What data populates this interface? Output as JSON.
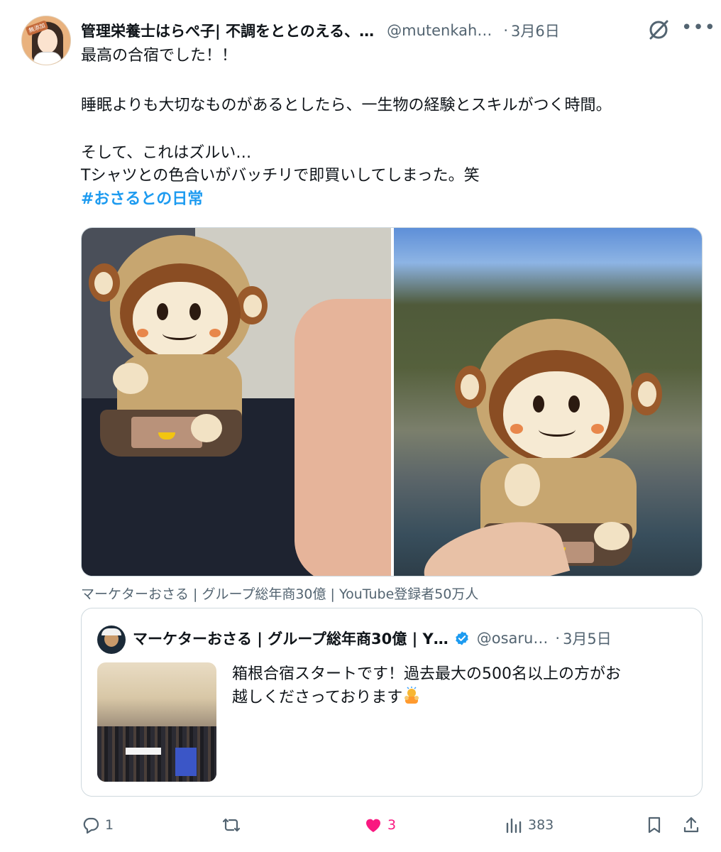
{
  "author": {
    "display_name": "管理栄養士はらぺ子| 不調をととのえる、…",
    "handle": "@mutenkah…",
    "separator": "·",
    "date": "3月6日",
    "avatar_badge": "無添加"
  },
  "icons": {
    "grok": "grok-icon",
    "more": "more-icon",
    "more_glyph": "•••"
  },
  "body": {
    "line1": "最高の合宿でした！！",
    "line2": "睡眠よりも大切なものがあるとしたら、一生物の経験とスキルがつく時間。",
    "line3": "そして、これはズルい…",
    "line4": "Tシャツとの色合いがバッチリで即買いしてしまった。笑",
    "hashtag": "#おさるとの日常"
  },
  "media": {
    "caption": "マーケターおさる | グループ総年商30億 | YouTube登録者50万人"
  },
  "quote": {
    "display_name": "マーケターおさる | グループ総年商30億 | Y…",
    "handle": "@osaru…",
    "separator": "·",
    "date": "3月5日",
    "text_line1": "箱根合宿スタートです！過去最大の500名以上の方がお",
    "text_line2": "越しくださっております"
  },
  "actions": {
    "replies": "1",
    "retweets": "",
    "likes": "3",
    "views": "383"
  },
  "colors": {
    "link": "#1d9bf0",
    "like": "#f91880",
    "muted": "#536471",
    "verified": "#1d9bf0"
  }
}
